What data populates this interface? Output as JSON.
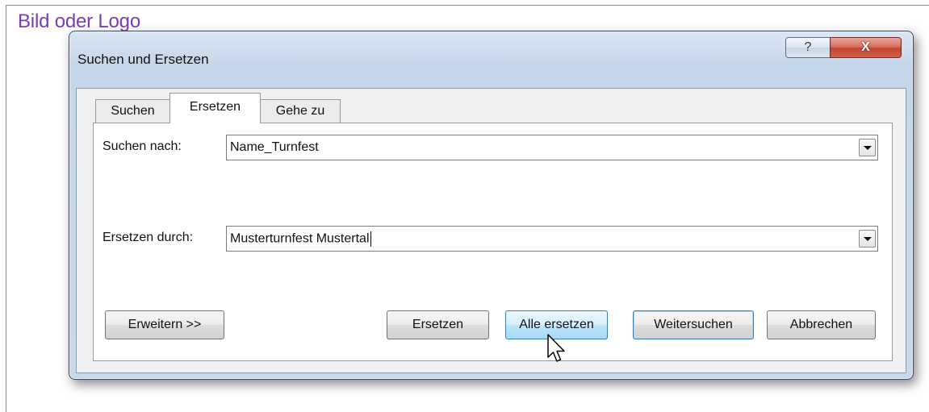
{
  "page": {
    "label": "Bild oder Logo"
  },
  "dialog": {
    "title": "Suchen und Ersetzen",
    "help_glyph": "?",
    "close_glyph": "X",
    "tabs": [
      {
        "label": "Suchen",
        "active": false
      },
      {
        "label": "Ersetzen",
        "active": true
      },
      {
        "label": "Gehe zu",
        "active": false
      }
    ],
    "search_label": "Suchen nach:",
    "search_value": "Name_Turnfest",
    "replace_label": "Ersetzen durch:",
    "replace_value": "Musterturnfest Mustertal",
    "buttons": {
      "expand": "Erweitern >>",
      "replace": "Ersetzen",
      "replace_all": "Alle ersetzen",
      "find_next": "Weitersuchen",
      "cancel": "Abbrechen"
    }
  },
  "colors": {
    "page_label": "#7a3fb0",
    "close_button": "#c8503c",
    "title_bar": "#c6d6e9"
  }
}
